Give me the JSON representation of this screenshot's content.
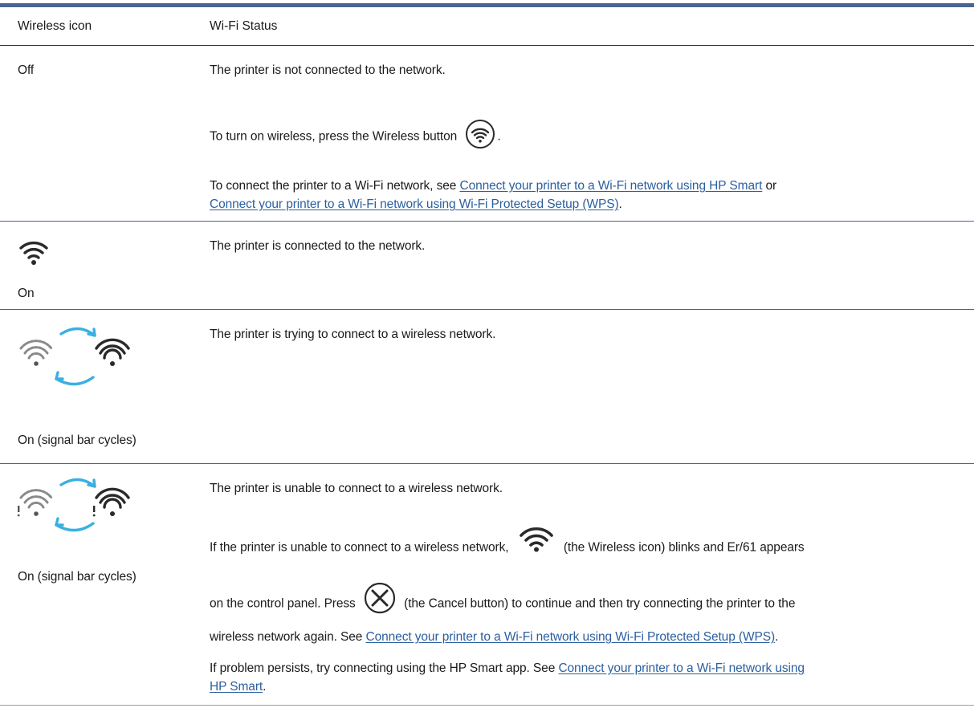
{
  "table": {
    "headers": [
      "Wireless icon",
      "Wi-Fi Status"
    ],
    "rows": [
      {
        "state": "Off",
        "status_line1": "The printer is not connected to the network.",
        "turn_on_prefix": "To turn on wireless, press the Wireless button",
        "turn_on_suffix": ".",
        "connect_prefix": "To connect the printer to a Wi-Fi network, see",
        "link_smart": "Connect your printer to a Wi-Fi network using HP Smart",
        "connect_or": "or",
        "link_wps": "Connect your printer to a Wi-Fi network using Wi-Fi Protected Setup (WPS)",
        "end_period": "."
      },
      {
        "state": "On",
        "status_line1": "The printer is connected to the network."
      },
      {
        "state": "On (signal bar cycles)",
        "status_line1": "The printer is trying to connect to a wireless network."
      },
      {
        "state": "On (signal bar cycles)",
        "status_line1": "The printer is unable to connect to a wireless network.",
        "para1_prefix": "If the printer is unable to connect to a wireless network,",
        "para1_suffix": "(the Wireless icon) blinks and Er/61 appears",
        "para2_prefix": "on the control panel. Press",
        "para2_suffix": "(the Cancel button) to continue and then try connecting the printer to the",
        "para3_prefix": "wireless network again. See",
        "link_wps": "Connect your printer to a Wi-Fi network using Wi-Fi Protected Setup (WPS)",
        "end_period": ".",
        "para4_prefix": "If problem persists, try connecting using the HP Smart app. See",
        "link_smart_a": "Connect your printer to a Wi-Fi network using",
        "link_smart_b": "HP Smart"
      }
    ]
  },
  "icons": [
    "wireless-icon",
    "wireless-button-icon",
    "wireless-cycle-icon",
    "wireless-error-cycle-icon",
    "cancel-button-icon"
  ],
  "colors": {
    "rule": "#4a6593",
    "link": "#2b5f9e",
    "cycle_arrow": "#3ab0e0",
    "icon": "#2a2a2a"
  }
}
